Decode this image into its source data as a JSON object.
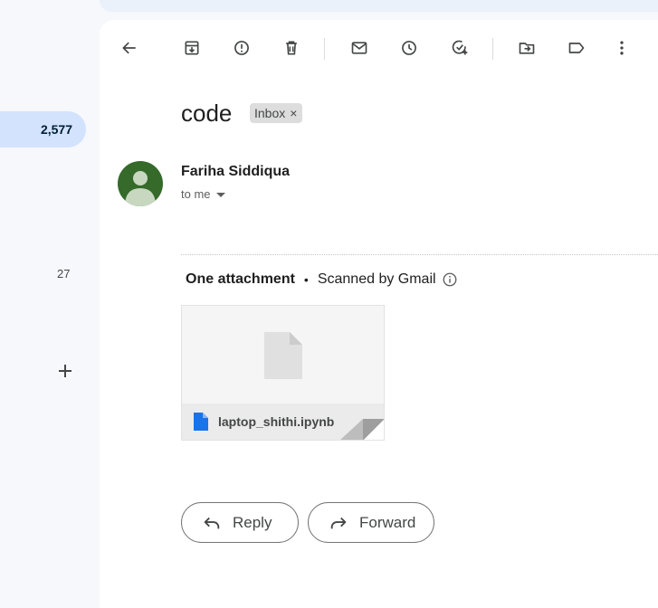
{
  "sidebar": {
    "inbox_count": "2,577",
    "drafts_count": "27",
    "add_icon": "plus-icon"
  },
  "toolbar": {
    "icons": [
      "back-arrow-icon",
      "archive-icon",
      "report-spam-icon",
      "delete-icon",
      "mark-unread-icon",
      "snooze-icon",
      "add-to-tasks-icon",
      "move-to-icon",
      "labels-icon",
      "more-options-icon"
    ]
  },
  "email": {
    "subject": "code",
    "label": "Inbox",
    "label_remove": "×",
    "sender": "Fariha Siddiqua",
    "recipient": "to me"
  },
  "attachments": {
    "count_text": "One attachment",
    "separator": "•",
    "scan_text": "Scanned by Gmail",
    "file_name": "laptop_shithi.ipynb"
  },
  "actions": {
    "reply": "Reply",
    "forward": "Forward"
  },
  "colors": {
    "accent": "#d3e3fd",
    "avatar_bg": "#356a2b",
    "file_blue": "#1a73e8"
  }
}
